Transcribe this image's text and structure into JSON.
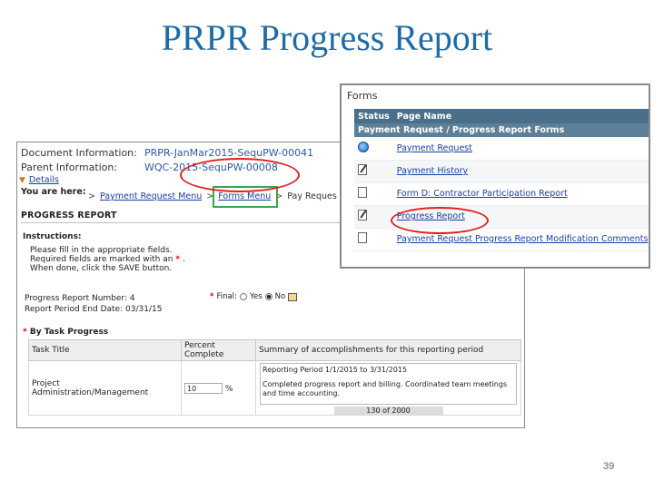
{
  "title": "PRPR Progress Report",
  "page_number": "39",
  "main_screenshot": {
    "doc_info": {
      "document_label": "Document Information:",
      "document_value": "PRPR-JanMar2015-SequPW-00041",
      "parent_label": "Parent Information:",
      "parent_value": "WQC-2015-SequPW-00008",
      "details_link": "Details"
    },
    "breadcrumb": {
      "you_are_here": "You are here:",
      "items": [
        "Payment Request Menu",
        "Forms Menu",
        "Pay Reques"
      ],
      "separator": ">"
    },
    "report_title": "PROGRESS REPORT",
    "instructions": {
      "heading": "Instructions:",
      "line1": "Please fill in the appropriate fields.",
      "line2": "Required fields are marked with an",
      "required_marker": "*",
      "line3": "When done, click the SAVE button."
    },
    "fields": {
      "report_number_label": "Progress Report Number:",
      "report_number_value": "4",
      "period_end_label": "Report Period End Date:",
      "period_end_value": "03/31/15",
      "final_label": "Final:",
      "final_options": [
        "Yes",
        "No"
      ],
      "final_selected": "No"
    },
    "task_progress": {
      "heading": "By Task Progress",
      "columns": [
        "Task Title",
        "Percent Complete",
        "Summary of accomplishments for this reporting period"
      ],
      "row": {
        "task_title": "Project Administration/Management",
        "percent": "10",
        "percent_unit": "%",
        "summary_period": "Reporting Period 1/1/2015 to 3/31/2015",
        "summary_text": "Completed progress report and billing. Coordinated team meetings and time accounting.",
        "char_count": "130 of 2000"
      }
    }
  },
  "forms_screenshot": {
    "label": "Forms",
    "columns": [
      "Status",
      "Page Name"
    ],
    "group": "Payment Request / Progress Report Forms",
    "items": [
      {
        "icon": "globe-icon",
        "label": "Payment Request"
      },
      {
        "icon": "edit-document-icon",
        "label": "Payment History"
      },
      {
        "icon": "document-icon",
        "label": "Form D: Contractor Participation Report"
      },
      {
        "icon": "edit-document-icon",
        "label": "Progress Report"
      },
      {
        "icon": "document-icon",
        "label": "Payment Request Progress Report Modification Comments"
      }
    ]
  },
  "colors": {
    "title": "#1f6ba5",
    "link": "#1a3fa0",
    "highlight_circle": "#e02020",
    "highlight_box": "#3aa64a",
    "table_header": "#4a6f8a"
  }
}
